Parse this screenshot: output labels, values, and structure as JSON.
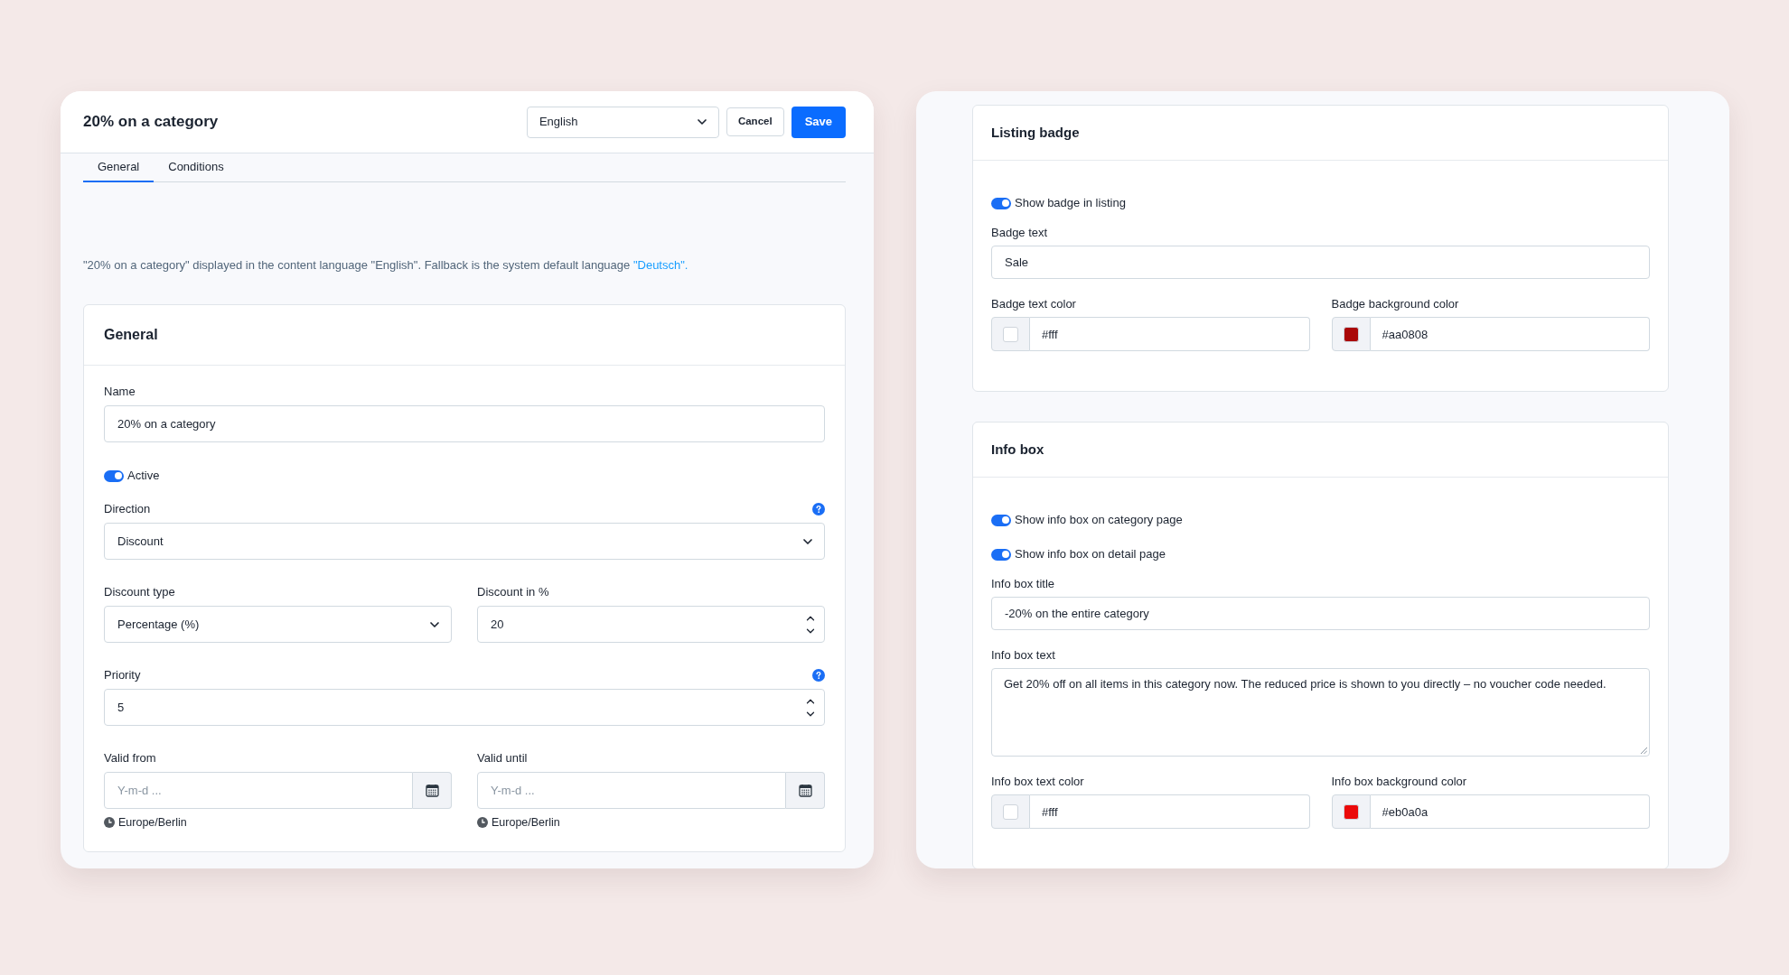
{
  "editor": {
    "title": "20% on a category",
    "language_select": "English",
    "buttons": [
      {
        "kind": "secondary",
        "label": "Cancel"
      },
      {
        "kind": "primary",
        "label": "Save"
      }
    ],
    "tabs": [
      {
        "label": "General",
        "selected": true
      },
      {
        "label": "Conditions",
        "selected": false
      }
    ],
    "notice": {
      "text": "\"20% on a category\" displayed in the content language \"English\". Fallback is the system default language",
      "link": "\"Deutsch\"."
    },
    "card": {
      "title": "General",
      "rows": [
        [
          {
            "kind": "text",
            "label": "Name",
            "value": "20% on a category",
            "help": false
          }
        ],
        [
          {
            "kind": "toggle",
            "label": "Active",
            "on": true
          }
        ],
        [
          {
            "kind": "select",
            "label": "Direction",
            "value": "Discount",
            "help": true
          }
        ],
        [
          {
            "kind": "select",
            "label": "Discount type",
            "value": "Percentage (%)",
            "help": false
          },
          {
            "kind": "number",
            "label": "Discount in %",
            "value": "20",
            "help": false
          }
        ],
        [
          {
            "kind": "number",
            "label": "Priority",
            "value": "5",
            "help": true
          }
        ],
        [
          {
            "kind": "date",
            "label": "Valid from",
            "placeholder": "Y-m-d ...",
            "timezone": "Europe/Berlin",
            "help": false
          },
          {
            "kind": "date",
            "label": "Valid until",
            "placeholder": "Y-m-d ...",
            "timezone": "Europe/Berlin",
            "help": false
          }
        ]
      ]
    }
  },
  "settings_panel": {
    "cards": [
      {
        "title": "Listing badge",
        "rows": [
          [
            {
              "kind": "toggle",
              "label": "Show badge in listing",
              "on": true
            }
          ],
          [
            {
              "kind": "text",
              "label": "Badge text",
              "value": "Sale",
              "help": false
            }
          ],
          [
            {
              "kind": "color",
              "label": "Badge text color",
              "value": "#fff",
              "color": "#ffffff"
            },
            {
              "kind": "color",
              "label": "Badge background color",
              "value": "#aa0808",
              "color": "#aa0808"
            }
          ]
        ]
      },
      {
        "title": "Info box",
        "rows": [
          [
            {
              "kind": "toggle",
              "label": "Show info box on category page",
              "on": true
            }
          ],
          [
            {
              "kind": "toggle",
              "label": "Show info box on detail page",
              "on": true
            }
          ],
          [
            {
              "kind": "text",
              "label": "Info box title",
              "value": "-20% on the entire category",
              "help": false
            }
          ],
          [
            {
              "kind": "textarea",
              "label": "Info box text",
              "value": "Get 20% off on all items in this category now. The reduced price is shown to you directly – no voucher code needed."
            }
          ],
          [
            {
              "kind": "color",
              "label": "Info box text color",
              "value": "#fff",
              "color": "#ffffff"
            },
            {
              "kind": "color",
              "label": "Info box background color",
              "value": "#eb0a0a",
              "color": "#eb0a0a"
            }
          ]
        ]
      }
    ]
  }
}
